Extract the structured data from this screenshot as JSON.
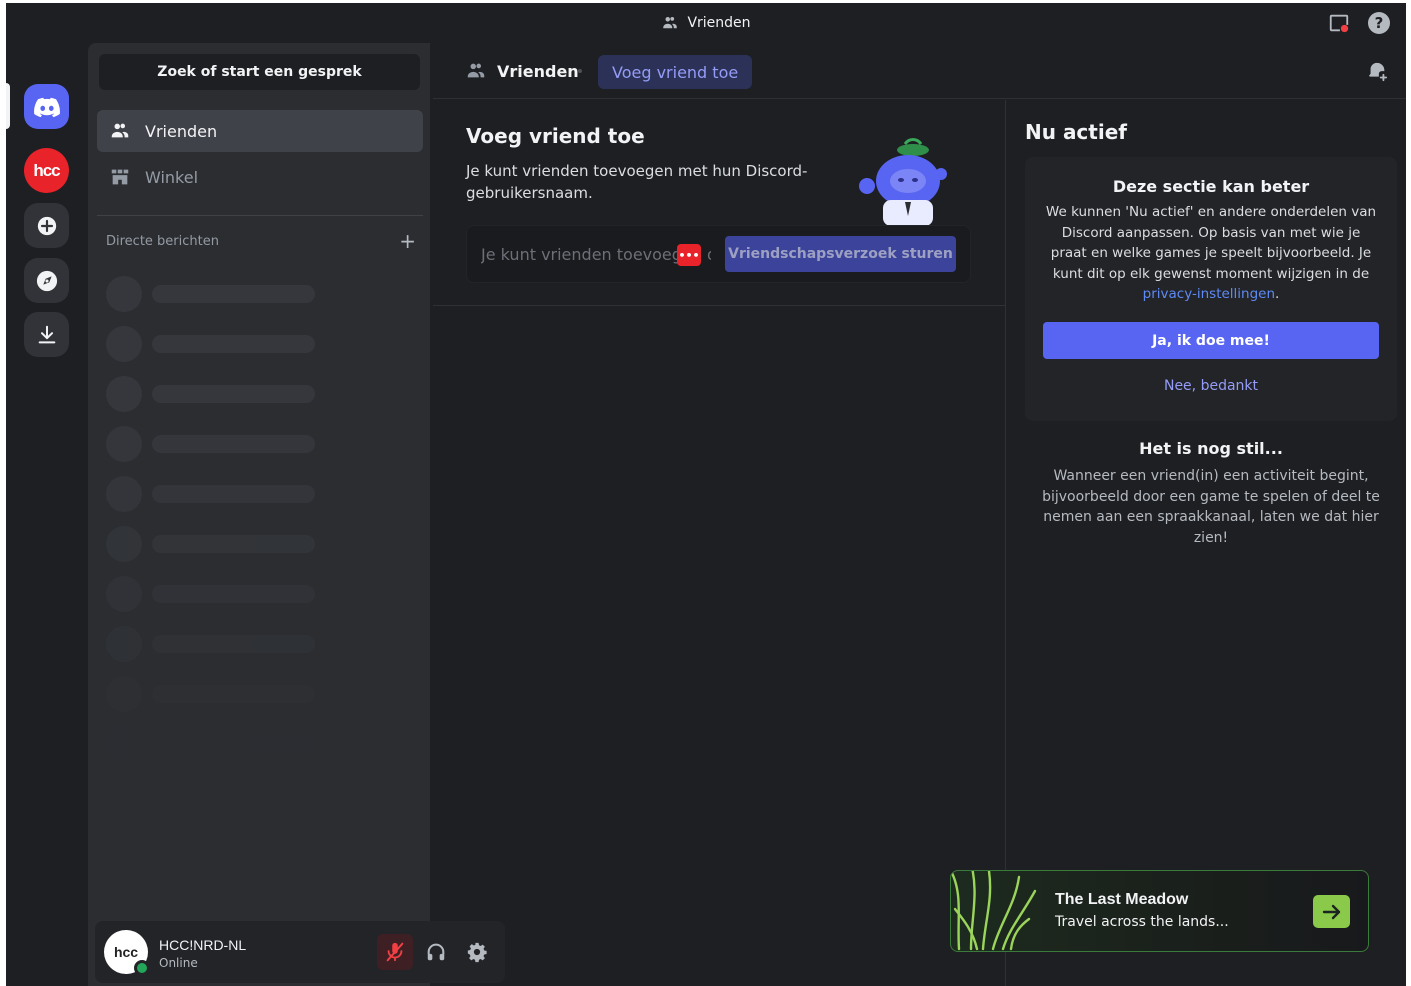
{
  "window": {
    "title": "Vrienden"
  },
  "rail": {
    "items": [
      {
        "name": "home",
        "icon": "discord-logo-icon"
      },
      {
        "name": "server-hcc",
        "label": "hcc"
      },
      {
        "name": "add-server",
        "icon": "plus-icon"
      },
      {
        "name": "explore",
        "icon": "compass-icon"
      },
      {
        "name": "download",
        "icon": "download-icon"
      }
    ]
  },
  "sidebar": {
    "search_label": "Zoek of start een gesprek",
    "nav": [
      {
        "label": "Vrienden",
        "icon": "friends-icon",
        "active": true
      },
      {
        "label": "Winkel",
        "icon": "shop-icon",
        "active": false
      }
    ],
    "dm_header": "Directe berichten",
    "dm_add": "+"
  },
  "user": {
    "avatar_text": "hcc",
    "name": "HCC!NRD-NL",
    "status": "Online"
  },
  "header": {
    "title": "Vrienden",
    "active_tab": "Voeg vriend toe"
  },
  "add_friend": {
    "title": "Voeg vriend toe",
    "description": "Je kunt vrienden toevoegen met hun Discord-gebruikersnaam.",
    "input_placeholder": "Je kunt vrienden toevoegen door",
    "send_label": "Vriendschapsverzoek sturen"
  },
  "now_active": {
    "title": "Nu actief",
    "card_title": "Deze sectie kan beter",
    "card_body": "We kunnen 'Nu actief' en andere onderdelen van Discord aanpassen. Op basis van met wie je praat en welke games je speelt bijvoorbeeld. Je kunt dit op elk gewenst moment wijzigen in de ",
    "card_link": "privacy-instellingen",
    "card_body_end": ".",
    "yes_label": "Ja, ik doe mee!",
    "no_label": "Nee, bedankt",
    "quiet_title": "Het is nog stil...",
    "quiet_body": "Wanneer een vriend(in) een activiteit begint, bijvoorbeeld door een game te spelen of deel te nemen aan een spraakkanaal, laten we dat hier zien!"
  },
  "promo": {
    "title": "The Last Meadow",
    "subtitle": "Travel across the lands..."
  },
  "colors": {
    "blurple": "#5865f2",
    "online": "#23a55a",
    "hcc_red": "#e8232a",
    "promo_green": "#8bc94a"
  }
}
